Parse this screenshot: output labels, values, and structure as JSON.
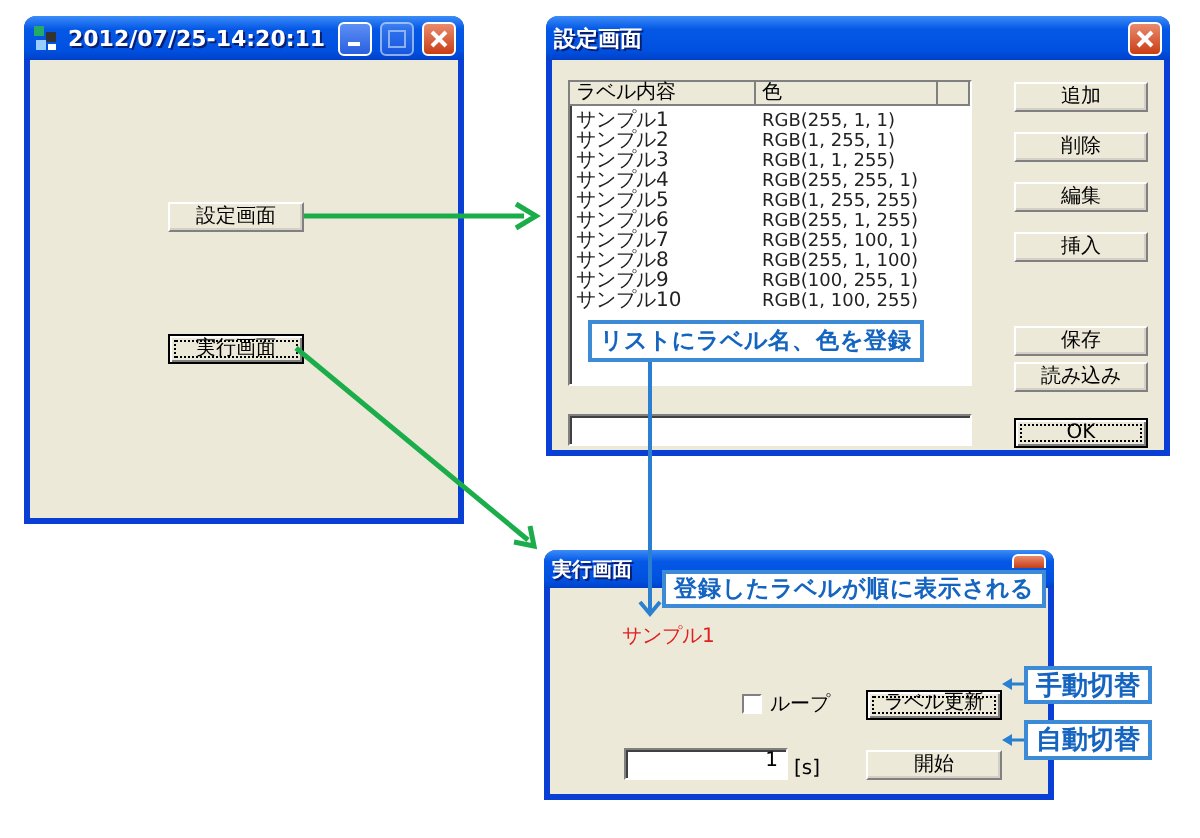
{
  "main_window": {
    "title": "2012/07/25-14:20:11",
    "buttons": [
      {
        "label": "設定画面",
        "focused": false
      },
      {
        "label": "実行画面",
        "focused": true
      }
    ]
  },
  "settings_window": {
    "title": "設定画面",
    "list": {
      "columns": [
        "ラベル内容",
        "色"
      ],
      "rows": [
        {
          "label": "サンプル1",
          "rgb_text": "RGB(255, 1, 1)"
        },
        {
          "label": "サンプル2",
          "rgb_text": "RGB(1, 255, 1)"
        },
        {
          "label": "サンプル3",
          "rgb_text": "RGB(1, 1, 255)"
        },
        {
          "label": "サンプル4",
          "rgb_text": "RGB(255, 255, 1)"
        },
        {
          "label": "サンプル5",
          "rgb_text": "RGB(1, 255, 255)"
        },
        {
          "label": "サンプル6",
          "rgb_text": "RGB(255, 1, 255)"
        },
        {
          "label": "サンプル7",
          "rgb_text": "RGB(255, 100, 1)"
        },
        {
          "label": "サンプル8",
          "rgb_text": "RGB(255, 1, 100)"
        },
        {
          "label": "サンプル9",
          "rgb_text": "RGB(100, 255, 1)"
        },
        {
          "label": "サンプル10",
          "rgb_text": "RGB(1, 100, 255)"
        }
      ]
    },
    "button_groups": [
      [
        {
          "label": "追加",
          "focused": false
        },
        {
          "label": "削除",
          "focused": false
        },
        {
          "label": "編集",
          "focused": false
        },
        {
          "label": "挿入",
          "focused": false
        }
      ],
      [
        {
          "label": "保存",
          "focused": false
        },
        {
          "label": "読み込み",
          "focused": false
        }
      ],
      [
        {
          "label": "OK",
          "focused": true
        }
      ]
    ]
  },
  "run_window": {
    "title": "実行画面",
    "current_label": "サンプル1",
    "loop": {
      "label": "ループ",
      "checked": false
    },
    "update_button": {
      "label": "ラベル更新",
      "focused": true
    },
    "interval": {
      "value": "1",
      "unit": "[s]"
    },
    "start_button": {
      "label": "開始",
      "focused": false
    }
  },
  "callouts": [
    {
      "text": "リストにラベル名、色を登録"
    },
    {
      "text": "登録したラベルが順に表示される"
    },
    {
      "text": "手動切替"
    },
    {
      "text": "自動切替"
    }
  ]
}
